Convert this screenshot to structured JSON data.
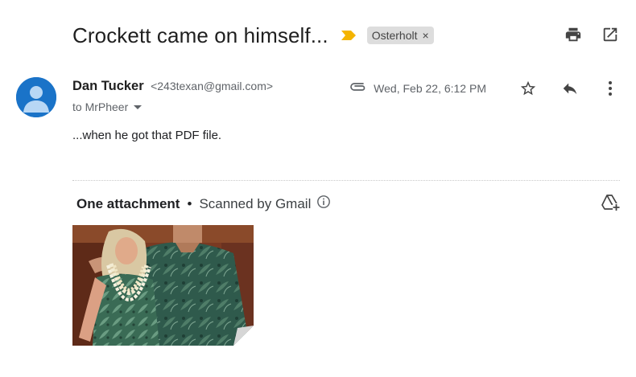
{
  "email": {
    "subject": "Crockett came on himself...",
    "label": "Osterholt",
    "label_remove": "×",
    "sender_name": "Dan Tucker",
    "sender_email": "<243texan@gmail.com>",
    "to_text": "to MrPheer",
    "date": "Wed, Feb 22, 6:12 PM",
    "body": "...when he got that PDF file."
  },
  "attachments": {
    "count_label": "One attachment",
    "separator": "•",
    "scan_label": "Scanned by Gmail"
  },
  "icons": {
    "importance": "importance-marker-icon",
    "print": "print-icon",
    "open_new_window": "open-in-new-window-icon",
    "attachment": "paperclip-icon",
    "star": "star-icon",
    "reply": "reply-icon",
    "more": "more-vert-icon",
    "info": "info-icon",
    "add_to_drive": "add-to-drive-icon"
  },
  "colors": {
    "avatar_bg": "#1a73c8",
    "importance": "#f4b400",
    "label_chip_bg": "#dddddd"
  }
}
